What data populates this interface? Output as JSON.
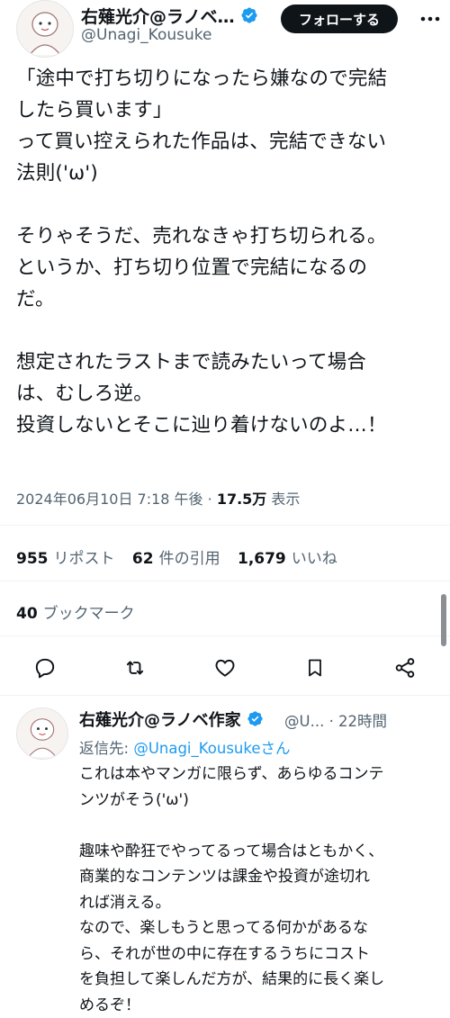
{
  "tweet": {
    "display_name": "右薙光介@ラノベ…",
    "handle": "@Unagi_Kousuke",
    "follow_label": "フォローする",
    "text": "「途中で打ち切りになったら嫌なので完結\nしたら買います」\nって買い控えられた作品は、完結できない\n法則('ω')\n\nそりゃそうだ、売れなきゃ打ち切られる。\nというか、打ち切り位置で完結になるの\nだ。\n\n想定されたラストまで読みたいって場合\nは、むしろ逆。\n投資しないとそこに辿り着けないのよ…！",
    "timestamp": "2024年06月10日 7:18 午後",
    "dot": "·",
    "views_count": "17.5万",
    "views_label": "表示",
    "stats": {
      "reposts_count": "955",
      "reposts_label": "リポスト",
      "quotes_count": "62",
      "quotes_label": "件の引用",
      "likes_count": "1,679",
      "likes_label": "いいね",
      "bookmarks_count": "40",
      "bookmarks_label": "ブックマーク"
    },
    "actions": [
      "reply-icon",
      "repost-icon",
      "like-icon",
      "bookmark-icon",
      "share-icon"
    ]
  },
  "reply": {
    "display_name": "右薙光介@ラノベ作家",
    "handle": "@U...",
    "time": "· 22時間",
    "reply_to_prefix": "返信先: ",
    "reply_to_handle": "@Unagi_Kousuke",
    "reply_to_suffix": "さん",
    "text": "これは本やマンガに限らず、あらゆるコンテ\nンツがそう('ω')\n\n趣味や酔狂でやってるって場合はともかく、\n商業的なコンテンツは課金や投資が途切れ\nれば消える。\nなので、楽しもうと思ってる何かがあるな\nら、それが世の中に存在するうちにコスト\nを負担して楽しんだ方が、結果的に長く楽し\nめるぞ！"
  },
  "colors": {
    "text": "#0f1419",
    "secondary": "#536471",
    "verified": "#1d9bf0",
    "link": "#1d9bf0",
    "divider": "#eff3f4"
  }
}
